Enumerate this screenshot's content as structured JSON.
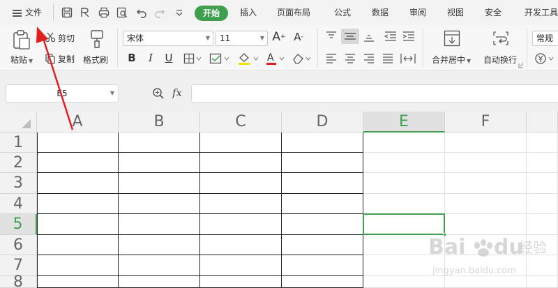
{
  "menubar": {
    "file_label": "文件",
    "tabs": [
      "开始",
      "插入",
      "页面布局",
      "公式",
      "数据",
      "审阅",
      "视图",
      "安全",
      "开发工具"
    ],
    "active_tab": "开始"
  },
  "ribbon": {
    "paste_label": "粘贴",
    "cut_label": "剪切",
    "copy_label": "复制",
    "format_painter_label": "格式刷",
    "font_name": "宋体",
    "font_size": "11",
    "bold": "B",
    "italic": "I",
    "underline": "U",
    "merge_center_label": "合并居中",
    "wrap_text_label": "自动换行",
    "number_format": "常规",
    "increase_font": "A",
    "decrease_font": "A"
  },
  "formula_bar": {
    "name_box": "E5",
    "fx_label": "fx",
    "formula_value": ""
  },
  "sheet": {
    "columns": [
      "A",
      "B",
      "C",
      "D",
      "E",
      "F"
    ],
    "rows": [
      "1",
      "2",
      "3",
      "4",
      "5",
      "6",
      "7",
      "8"
    ],
    "active_cell": "E5",
    "selected_column": "E",
    "selected_row": "5",
    "bordered_range": "A1:D8"
  },
  "colors": {
    "accent": "#3f9f4f",
    "annotation_arrow": "#e02020"
  },
  "watermark": {
    "brand": "Bai",
    "brand_suffix": "du",
    "product": "经验",
    "url": "jingyan.baidu.com"
  }
}
